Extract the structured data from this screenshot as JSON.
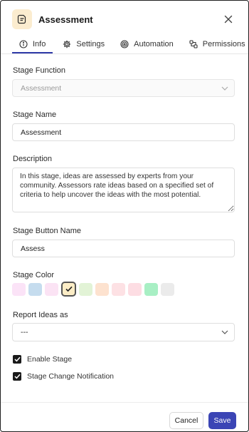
{
  "header": {
    "title": "Assessment"
  },
  "tabs": [
    {
      "label": "Info",
      "icon": "info-icon"
    },
    {
      "label": "Settings",
      "icon": "gear-icon"
    },
    {
      "label": "Automation",
      "icon": "automation-icon"
    },
    {
      "label": "Permissions",
      "icon": "permissions-icon"
    }
  ],
  "fields": {
    "stage_function": {
      "label": "Stage Function",
      "value": "Assessment"
    },
    "stage_name": {
      "label": "Stage Name",
      "value": "Assessment"
    },
    "description": {
      "label": "Description",
      "value": "In this stage, ideas are assessed by experts from your community. Assessors rate ideas based on a specified set of criteria to help uncover the ideas with the most potential."
    },
    "button_name": {
      "label": "Stage Button Name",
      "value": "Assess"
    },
    "stage_color": {
      "label": "Stage Color",
      "options": [
        "#fbe3f7",
        "#c5dcee",
        "#fbe3f4",
        "#fcedc6",
        "#e2f3d6",
        "#fde2cf",
        "#fde1e4",
        "#fddde3",
        "#a8efc4",
        "#ebebeb"
      ],
      "selected_index": 3
    },
    "report_as": {
      "label": "Report Ideas as",
      "value": "---"
    }
  },
  "checkboxes": {
    "enable_stage": {
      "label": "Enable Stage",
      "checked": true
    },
    "change_notification": {
      "label": "Stage Change Notification",
      "checked": true
    }
  },
  "footer": {
    "cancel_label": "Cancel",
    "save_label": "Save"
  },
  "colors": {
    "accent": "#3b45b5",
    "tab_underline": "#2f3aa8",
    "icon_bg": "#fbeccf"
  }
}
